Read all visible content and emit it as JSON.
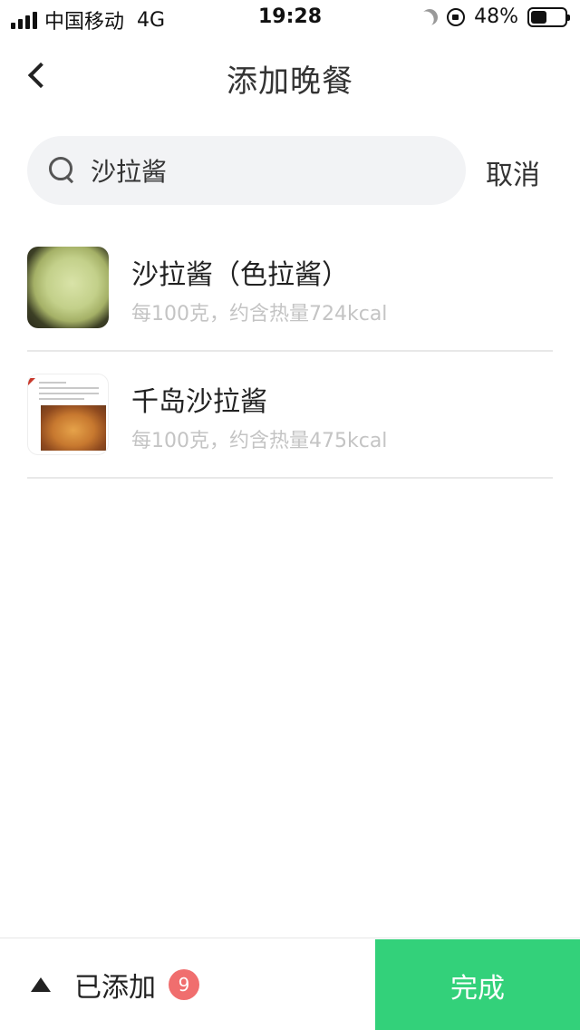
{
  "status_bar": {
    "carrier": "中国移动",
    "network": "4G",
    "time": "19:28",
    "battery": "48%",
    "battery_level": 0.48
  },
  "nav": {
    "title": "添加晚餐"
  },
  "search": {
    "value": "沙拉酱",
    "cancel_label": "取消"
  },
  "results": [
    {
      "name": "沙拉酱（色拉酱）",
      "desc": "每100克，约含热量724kcal"
    },
    {
      "name": "千岛沙拉酱",
      "desc": "每100克，约含热量475kcal"
    }
  ],
  "bottom_bar": {
    "added_label": "已添加",
    "added_count": "9",
    "done_label": "完成"
  },
  "colors": {
    "accent": "#33d17a",
    "badge": "#f06e6e"
  }
}
